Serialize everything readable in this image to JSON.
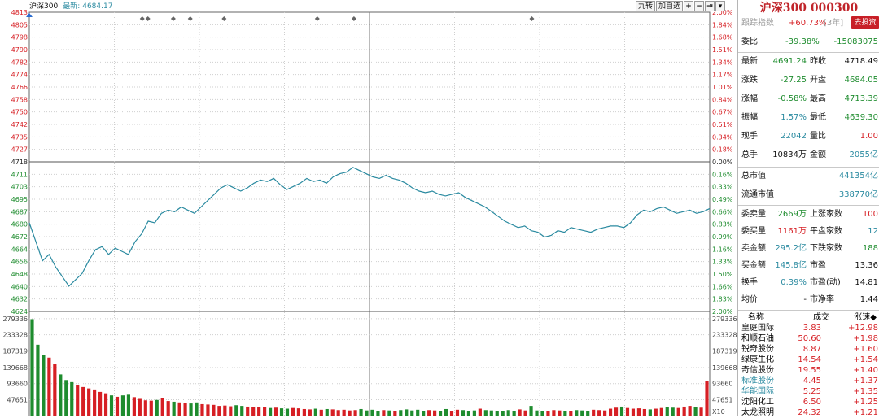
{
  "chart": {
    "name": "沪深300",
    "latest_label": "最新:",
    "latest_value": "4684.17",
    "volume_label": "X10",
    "price_ticks": [
      "4813",
      "4805",
      "4798",
      "4790",
      "4782",
      "4774",
      "4766",
      "4758",
      "4750",
      "4742",
      "4735",
      "4727",
      "4718",
      "4711",
      "4703",
      "4695",
      "4687",
      "4680",
      "4672",
      "4664",
      "4656",
      "4648",
      "4640",
      "4632",
      "4624"
    ],
    "pct_ticks": [
      "2.00%",
      "1.84%",
      "1.68%",
      "1.51%",
      "1.34%",
      "1.17%",
      "1.01%",
      "0.84%",
      "0.67%",
      "0.51%",
      "0.34%",
      "0.18%",
      "0.00%",
      "0.16%",
      "0.33%",
      "0.49%",
      "0.66%",
      "0.83%",
      "0.99%",
      "1.16%",
      "1.33%",
      "1.50%",
      "1.66%",
      "1.83%",
      "2.00%"
    ],
    "volume_ticks": [
      "279336",
      "233328",
      "187319",
      "139668",
      "93660",
      "47651"
    ],
    "toolbar": [
      "九转",
      "加自选",
      "+",
      "−",
      "⇥",
      "▾"
    ],
    "colors": {
      "up": "#d61f24",
      "down": "#1e8c2e",
      "line": "#2a8aa0",
      "grid": "#cfcfcf"
    }
  },
  "chart_data": {
    "type": "line",
    "ylim": [
      4624,
      4813
    ],
    "base": 4718.49,
    "x_points": 242,
    "series": [
      {
        "values": [
          4680,
          4668,
          4656,
          4660,
          4652,
          4646,
          4640,
          4644,
          4648,
          4656,
          4663,
          4665,
          4660,
          4664,
          4662,
          4660,
          4668,
          4673,
          4681,
          4680,
          4686,
          4688,
          4687,
          4690,
          4688,
          4686,
          4690,
          4694,
          4698,
          4702,
          4704,
          4702,
          4700,
          4702,
          4705,
          4707,
          4706,
          4708,
          4704,
          4701,
          4703,
          4705,
          4708,
          4706,
          4707,
          4705,
          4709,
          4711,
          4712,
          4715,
          4713,
          4711,
          4709,
          4708,
          4710,
          4708,
          4707,
          4705,
          4702,
          4700,
          4699,
          4700,
          4698,
          4697,
          4698,
          4699,
          4696,
          4694,
          4692,
          4690,
          4687,
          4684,
          4681,
          4679,
          4677,
          4678,
          4675,
          4674,
          4671,
          4672,
          4675,
          4674,
          4677,
          4676,
          4675,
          4674,
          4676,
          4677,
          4678,
          4678,
          4677,
          4680,
          4685,
          4688,
          4687,
          4689,
          4690,
          4688,
          4686,
          4687,
          4688,
          4686,
          4687,
          4689
        ]
      }
    ],
    "volume": [
      278000,
      205000,
      176000,
      168000,
      150000,
      120000,
      104000,
      98000,
      90000,
      84000,
      80000,
      77000,
      70000,
      66000,
      60000,
      56000,
      60000,
      62000,
      55000,
      50000,
      46000,
      45000,
      47000,
      52000,
      44000,
      42000,
      40000,
      38000,
      37000,
      40000,
      35000,
      34000,
      33000,
      30000,
      31000,
      29000,
      32000,
      30000,
      28000,
      26000,
      26000,
      27000,
      24000,
      25000,
      23000,
      22000,
      24000,
      23000,
      21000,
      20000,
      22000,
      19000,
      21000,
      20000,
      18000,
      19000,
      17000,
      18000,
      21000,
      17000,
      19000,
      16000,
      18000,
      17000,
      16000,
      18000,
      20000,
      17000,
      19000,
      16000,
      18000,
      17000,
      16000,
      21000,
      15000,
      19000,
      18000,
      16000,
      17000,
      22000,
      18000,
      17000,
      16000,
      15000,
      18000,
      16000,
      20000,
      17000,
      30000,
      17000,
      15000,
      16000,
      18000,
      17000,
      16000,
      15000,
      18000,
      17000,
      16000,
      19000,
      18000,
      17000,
      22000,
      25000,
      28000,
      24000,
      22000,
      23000,
      21000,
      20000,
      22000,
      24000,
      26000,
      25000,
      24000,
      28000,
      30000,
      26000,
      25000,
      100000
    ],
    "markers": [
      40,
      42,
      51,
      57,
      69,
      102,
      115,
      178
    ]
  },
  "panel": {
    "title": "沪深300 000300",
    "track_label": "跟踪指数",
    "track_value": "+60.73%",
    "track_period": "[3年]",
    "track_button": "去投资",
    "weibi": {
      "label": "委比",
      "pct": "-39.38%",
      "diff": "-15083075"
    },
    "quote_rows": [
      {
        "l1": "最新",
        "v1": "4691.24",
        "c1": "green",
        "l2": "昨收",
        "v2": "4718.49",
        "c2": ""
      },
      {
        "l1": "涨跌",
        "v1": "-27.25",
        "c1": "green",
        "l2": "开盘",
        "v2": "4684.05",
        "c2": "green"
      },
      {
        "l1": "涨幅",
        "v1": "-0.58%",
        "c1": "green",
        "l2": "最高",
        "v2": "4713.39",
        "c2": "green"
      },
      {
        "l1": "振幅",
        "v1": "1.57%",
        "c1": "teal",
        "l2": "最低",
        "v2": "4639.30",
        "c2": "green"
      },
      {
        "l1": "现手",
        "v1": "22042",
        "c1": "teal",
        "l2": "量比",
        "v2": "1.00",
        "c2": "red"
      },
      {
        "l1": "总手",
        "v1": "10834万",
        "c1": "",
        "l2": "金额",
        "v2": "2055亿",
        "c2": "teal"
      }
    ],
    "cap_rows": [
      {
        "label": "总市值",
        "value": "441354亿"
      },
      {
        "label": "流通市值",
        "value": "338770亿"
      }
    ],
    "stat_rows": [
      {
        "l1": "委卖量",
        "v1": "2669万",
        "c1": "green",
        "l2": "上涨家数",
        "v2": "100",
        "c2": "red"
      },
      {
        "l1": "委买量",
        "v1": "1161万",
        "c1": "red",
        "l2": "平盘家数",
        "v2": "12",
        "c2": "teal"
      },
      {
        "l1": "卖金额",
        "v1": "295.2亿",
        "c1": "teal",
        "l2": "下跌家数",
        "v2": "188",
        "c2": "green"
      },
      {
        "l1": "买金额",
        "v1": "145.8亿",
        "c1": "teal",
        "l2": "市盈",
        "v2": "13.36",
        "c2": ""
      },
      {
        "l1": "换手",
        "v1": "0.39%",
        "c1": "teal",
        "l2": "市盈(动)",
        "v2": "14.81",
        "c2": ""
      },
      {
        "l1": "均价",
        "v1": "-",
        "c1": "",
        "l2": "市净率",
        "v2": "1.44",
        "c2": ""
      }
    ],
    "list_headers": [
      "名称",
      "成交",
      "涨速◆"
    ],
    "stocks": [
      {
        "name": "皇庭国际",
        "price": "3.83",
        "speed": "+12.98",
        "nc": ""
      },
      {
        "name": "和顺石油",
        "price": "50.60",
        "speed": "+1.98",
        "nc": ""
      },
      {
        "name": "锐奇股份",
        "price": "8.87",
        "speed": "+1.60",
        "nc": ""
      },
      {
        "name": "绿康生化",
        "price": "14.54",
        "speed": "+1.54",
        "nc": ""
      },
      {
        "name": "奇信股份",
        "price": "19.55",
        "speed": "+1.40",
        "nc": ""
      },
      {
        "name": "标准股份",
        "price": "4.45",
        "speed": "+1.37",
        "nc": "teal"
      },
      {
        "name": "华能国际",
        "price": "5.25",
        "speed": "+1.35",
        "nc": "teal"
      },
      {
        "name": "沈阳化工",
        "price": "6.50",
        "speed": "+1.25",
        "nc": ""
      },
      {
        "name": "太龙照明",
        "price": "24.32",
        "speed": "+1.21",
        "nc": ""
      }
    ]
  }
}
